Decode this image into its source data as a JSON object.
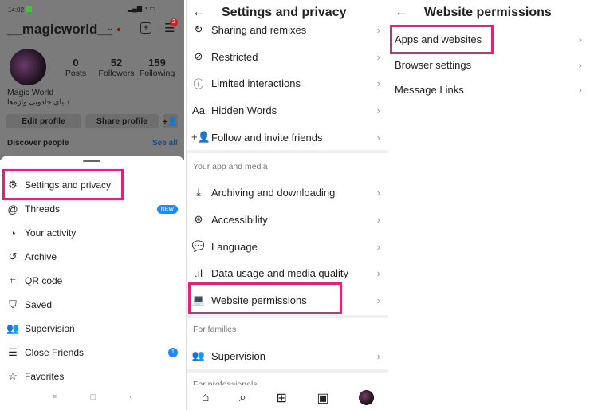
{
  "profile": {
    "status_time": "14:02",
    "username": "__magicworld__",
    "notif_count": "2",
    "stats": [
      {
        "value": "0",
        "label": "Posts"
      },
      {
        "value": "52",
        "label": "Followers"
      },
      {
        "value": "159",
        "label": "Following"
      }
    ],
    "name": "Magic World",
    "bio": "دنیای جادویی واژه‌ها",
    "edit_profile": "Edit profile",
    "share_profile": "Share profile",
    "discover": "Discover people",
    "see_all": "See all"
  },
  "menu": {
    "items": [
      {
        "label": "Settings and privacy",
        "icon": "gear-icon"
      },
      {
        "label": "Threads",
        "icon": "threads-icon",
        "badge": "NEW"
      },
      {
        "label": "Your activity",
        "icon": "activity-icon"
      },
      {
        "label": "Archive",
        "icon": "archive-icon"
      },
      {
        "label": "QR code",
        "icon": "qr-icon"
      },
      {
        "label": "Saved",
        "icon": "bookmark-icon"
      },
      {
        "label": "Supervision",
        "icon": "supervision-icon"
      },
      {
        "label": "Close Friends",
        "icon": "list-icon",
        "badge": "1"
      },
      {
        "label": "Favorites",
        "icon": "star-icon"
      }
    ]
  },
  "settings": {
    "title": "Settings and privacy",
    "items": [
      {
        "label": "Sharing and remixes"
      },
      {
        "label": "Restricted"
      },
      {
        "label": "Limited interactions"
      },
      {
        "label": "Hidden Words"
      },
      {
        "label": "Follow and invite friends"
      }
    ],
    "section_app": "Your app and media",
    "app_items": [
      {
        "label": "Archiving and downloading"
      },
      {
        "label": "Accessibility"
      },
      {
        "label": "Language"
      },
      {
        "label": "Data usage and media quality"
      },
      {
        "label": "Website permissions"
      }
    ],
    "section_families": "For families",
    "family_items": [
      {
        "label": "Supervision"
      }
    ],
    "section_pro": "For professionals"
  },
  "website_permissions": {
    "title": "Website permissions",
    "items": [
      {
        "label": "Apps and websites"
      },
      {
        "label": "Browser settings"
      },
      {
        "label": "Message Links"
      }
    ]
  },
  "colors": {
    "highlight": "#e0247a",
    "accent": "#1a8cff"
  }
}
